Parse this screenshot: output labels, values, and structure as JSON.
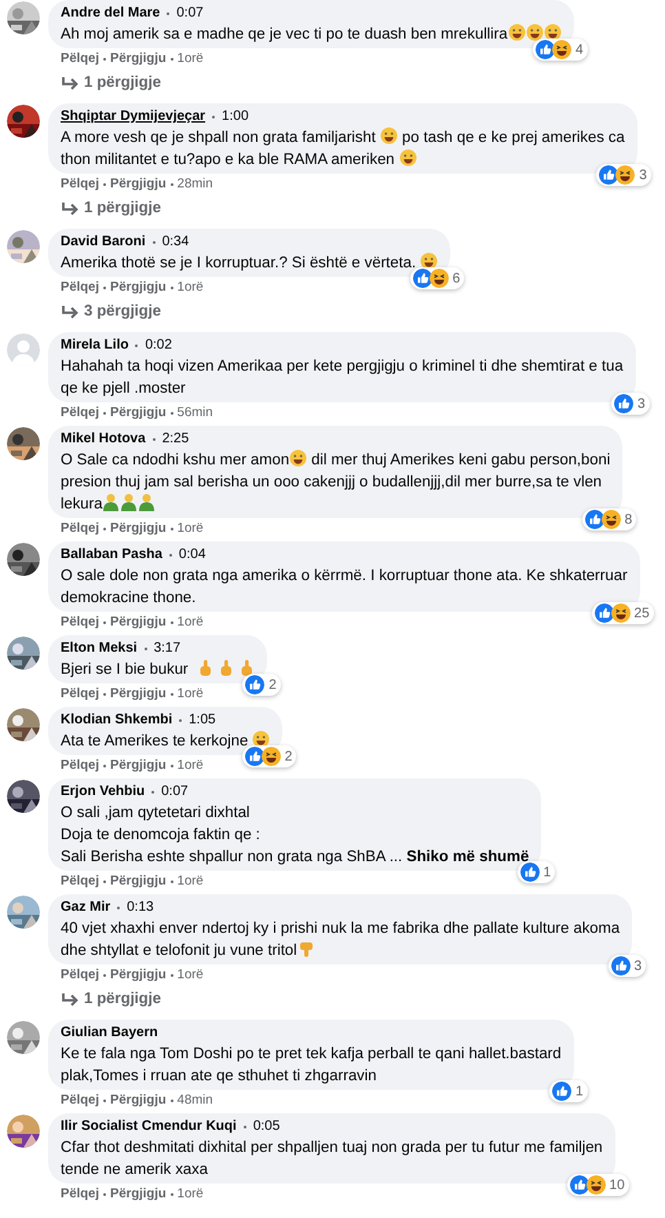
{
  "comments": [
    {
      "author": "Andre del Mare",
      "underlined": false,
      "time": "0:07",
      "avatar": {
        "kind": "picture"
      },
      "body": [
        [
          {
            "kind": "text",
            "text": "Ah moj amerik sa e madhe qe je vec ti po te duash ben mrekullira"
          },
          {
            "kind": "face"
          },
          {
            "kind": "face"
          },
          {
            "kind": "face"
          }
        ]
      ],
      "reactions": {
        "like": true,
        "haha": true,
        "count": "4"
      },
      "actions": [
        "Pëlqej",
        "Përgjigju"
      ],
      "age": "1orë",
      "replies": "1 përgjigje"
    },
    {
      "author": "Shqiptar Dymijevjeçar",
      "underlined": true,
      "time": "1:00",
      "avatar": {
        "kind": "picture"
      },
      "body": [
        [
          {
            "kind": "text",
            "text": "A more vesh qe je shpall non grata familjarisht "
          },
          {
            "kind": "face"
          },
          {
            "kind": "text",
            "text": " po tash qe e ke prej amerikes ca"
          }
        ],
        [
          {
            "kind": "text",
            "text": "thon militantet e tu?apo e ka ble RAMA ameriken "
          },
          {
            "kind": "face"
          }
        ]
      ],
      "reactions": {
        "like": true,
        "haha": true,
        "count": "3"
      },
      "actions": [
        "Pëlqej",
        "Përgjigju"
      ],
      "age": "28min",
      "replies": "1 përgjigje"
    },
    {
      "author": "David Baroni",
      "underlined": false,
      "time": "0:34",
      "avatar": {
        "kind": "picture"
      },
      "body": [
        [
          {
            "kind": "text",
            "text": "Amerika thotë se je I korruptuar.? Si është e vërteta. "
          },
          {
            "kind": "face"
          }
        ]
      ],
      "reactions": {
        "like": true,
        "haha": true,
        "count": "6"
      },
      "actions": [
        "Pëlqej",
        "Përgjigju"
      ],
      "age": "1orë",
      "replies": "3 përgjigje"
    },
    {
      "author": "Mirela Lilo",
      "underlined": false,
      "time": "0:02",
      "avatar": {
        "kind": "default"
      },
      "body": [
        [
          {
            "kind": "text",
            "text": "Hahahah ta hoqi vizen Amerikaa per kete pergjigju o kriminel ti dhe shemtirat e tua"
          }
        ],
        [
          {
            "kind": "text",
            "text": "qe ke pjell .moster"
          }
        ]
      ],
      "reactions": {
        "like": true,
        "haha": false,
        "count": "3"
      },
      "actions": [
        "Pëlqej",
        "Përgjigju"
      ],
      "age": "56min"
    },
    {
      "author": "Mikel Hotova",
      "underlined": false,
      "time": "2:25",
      "avatar": {
        "kind": "picture"
      },
      "body": [
        [
          {
            "kind": "text",
            "text": "O Sale ca ndodhi kshu mer amon"
          },
          {
            "kind": "face"
          },
          {
            "kind": "text",
            "text": " dil mer thuj Amerikes keni gabu person,boni"
          }
        ],
        [
          {
            "kind": "text",
            "text": "presion thuj jam sal berisha un ooo cakenjjj o budallenjjj,dil mer burre,sa te vlen"
          }
        ],
        [
          {
            "kind": "text",
            "text": "lekura"
          },
          {
            "kind": "person"
          },
          {
            "kind": "person"
          },
          {
            "kind": "person"
          }
        ]
      ],
      "reactions": {
        "like": true,
        "haha": true,
        "count": "8"
      },
      "actions": [
        "Pëlqej",
        "Përgjigju"
      ],
      "age": "1orë"
    },
    {
      "author": "Ballaban Pasha",
      "underlined": false,
      "time": "0:04",
      "avatar": {
        "kind": "picture"
      },
      "body": [
        [
          {
            "kind": "text",
            "text": "O sale dole non grata nga amerika o kërrmë. I korruptuar thone ata. Ke shkaterruar"
          }
        ],
        [
          {
            "kind": "text",
            "text": "demokracine thone."
          }
        ]
      ],
      "reactions": {
        "like": true,
        "haha": true,
        "count": "25"
      },
      "actions": [
        "Pëlqej",
        "Përgjigju"
      ],
      "age": "1orë"
    },
    {
      "author": "Elton Meksi",
      "underlined": false,
      "time": "3:17",
      "avatar": {
        "kind": "picture"
      },
      "body": [
        [
          {
            "kind": "text",
            "text": "Bjeri se I bie bukur "
          },
          {
            "kind": "hand"
          },
          {
            "kind": "hand"
          },
          {
            "kind": "hand"
          }
        ]
      ],
      "reactions": {
        "like": true,
        "haha": false,
        "count": "2"
      },
      "actions": [
        "Pëlqej",
        "Përgjigju"
      ],
      "age": "1orë"
    },
    {
      "author": "Klodian Shkembi",
      "underlined": false,
      "time": "1:05",
      "avatar": {
        "kind": "picture"
      },
      "body": [
        [
          {
            "kind": "text",
            "text": "Ata te Amerikes te kerkojne "
          },
          {
            "kind": "face"
          }
        ]
      ],
      "reactions": {
        "like": true,
        "haha": true,
        "count": "2"
      },
      "actions": [
        "Pëlqej",
        "Përgjigju"
      ],
      "age": "1orë"
    },
    {
      "author": "Erjon Vehbiu",
      "underlined": false,
      "time": "0:07",
      "avatar": {
        "kind": "picture"
      },
      "body": [
        [
          {
            "kind": "text",
            "text": "O sali ,jam qytetetari dixhtal"
          }
        ],
        [
          {
            "kind": "text",
            "text": "Doja te denomcoja faktin qe :"
          }
        ],
        [
          {
            "kind": "text",
            "text": "Sali Berisha eshte shpallur non grata nga ShBA ... "
          },
          {
            "kind": "link",
            "text": "Shiko më shumë"
          }
        ]
      ],
      "reactions": {
        "like": true,
        "haha": false,
        "count": "1"
      },
      "actions": [
        "Pëlqej",
        "Përgjigju"
      ],
      "age": "1orë"
    },
    {
      "author": "Gaz Mir",
      "underlined": false,
      "time": "0:13",
      "avatar": {
        "kind": "picture"
      },
      "body": [
        [
          {
            "kind": "text",
            "text": "40 vjet xhaxhi enver ndertoj ky i prishi nuk la me fabrika dhe pallate kulture akoma"
          }
        ],
        [
          {
            "kind": "text",
            "text": "dhe shtyllat e telofonit ju vune tritol"
          },
          {
            "kind": "thumb"
          }
        ]
      ],
      "reactions": {
        "like": true,
        "haha": false,
        "count": "3"
      },
      "actions": [
        "Pëlqej",
        "Përgjigju"
      ],
      "age": "1orë",
      "replies": "1 përgjigje"
    },
    {
      "author": "Giulian Bayern",
      "underlined": false,
      "avatar": {
        "kind": "picture"
      },
      "body": [
        [
          {
            "kind": "text",
            "text": "Ke te fala nga Tom Doshi po te pret tek kafja perball te qani hallet.bastard"
          }
        ],
        [
          {
            "kind": "text",
            "text": "plak,Tomes i rruan ate qe sthuhet ti zhgarravin"
          }
        ]
      ],
      "reactions": {
        "like": true,
        "haha": false,
        "count": "1"
      },
      "actions": [
        "Pëlqej",
        "Përgjigju"
      ],
      "age": "48min"
    },
    {
      "author": "Ilir Socialist Cmendur Kuqi",
      "underlined": false,
      "time": "0:05",
      "avatar": {
        "kind": "picture"
      },
      "body": [
        [
          {
            "kind": "text",
            "text": "Cfar thot deshmitati dixhital per shpalljen tuaj non grada per tu futur me familjen"
          }
        ],
        [
          {
            "kind": "text",
            "text": "tende ne amerik xaxa"
          }
        ]
      ],
      "reactions": {
        "like": true,
        "haha": true,
        "count": "10"
      },
      "actions": [
        "Pëlqej",
        "Përgjigju"
      ],
      "age": "1orë"
    }
  ]
}
